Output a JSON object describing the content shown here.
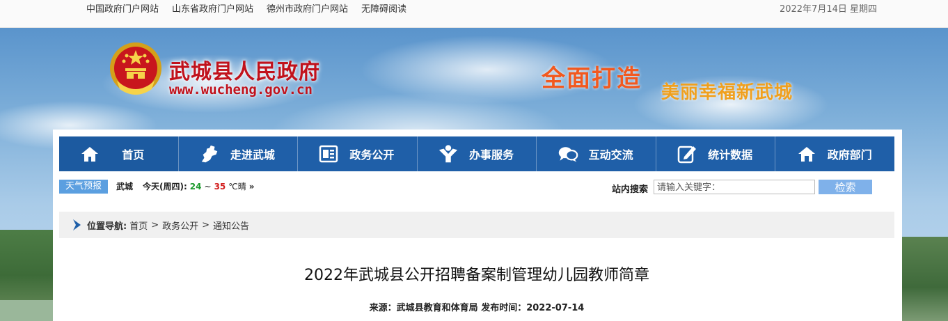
{
  "topbar": {
    "links": [
      "中国政府门户网站",
      "山东省政府门户网站",
      "德州市政府门户网站",
      "无障碍阅读"
    ],
    "date": "2022年7月14日 星期四"
  },
  "header": {
    "site_title": "武城县人民政府",
    "site_url": "www.wucheng.gov.cn",
    "slogan_main": "全面打造",
    "slogan_sub": "美丽幸福新武城"
  },
  "nav": {
    "items": [
      {
        "label": "首页",
        "icon": "home-icon"
      },
      {
        "label": "走进武城",
        "icon": "map-icon"
      },
      {
        "label": "政务公开",
        "icon": "document-icon"
      },
      {
        "label": "办事服务",
        "icon": "person-service-icon"
      },
      {
        "label": "互动交流",
        "icon": "chat-icon"
      },
      {
        "label": "统计数据",
        "icon": "edit-icon"
      },
      {
        "label": "政府部门",
        "icon": "building-icon"
      }
    ]
  },
  "weather": {
    "tag": "天气预报",
    "city": "武城",
    "today_label": "今天(周四):",
    "temp_low": "24",
    "tilde": "~",
    "temp_high": "35",
    "unit_condition": "℃晴",
    "more": "»"
  },
  "search": {
    "label": "站内搜索",
    "placeholder": "请输入关键字：",
    "button": "检索"
  },
  "breadcrumb": {
    "label": "位置导航:",
    "items": [
      "首页",
      "政务公开",
      "通知公告"
    ],
    "separator": ">"
  },
  "article": {
    "title": "2022年武城县公开招聘备案制管理幼儿园教师简章",
    "source_label": "来源：",
    "source": "武城县教育和体育局",
    "publish_label": "发布时间：",
    "publish_date": "2022-07-14"
  },
  "colors": {
    "nav_bg": "#1f5fa8",
    "title_red": "#c1121c",
    "slogan_orange": "#f2591f",
    "slogan_gold": "#f0a01e",
    "weather_tag_bg": "#5b9fe0",
    "search_btn_bg": "#7fb1ea"
  }
}
